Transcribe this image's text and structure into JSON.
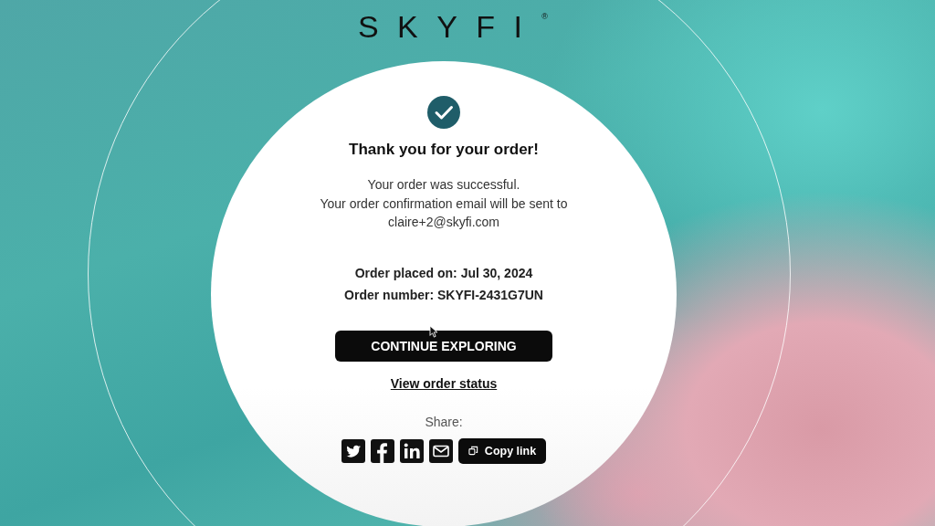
{
  "logo": {
    "text": "SKYFI",
    "mark": "®"
  },
  "confirmation": {
    "title": "Thank you for your order!",
    "message_lines": [
      "Your order was successful.",
      "Your order confirmation email will be sent to"
    ],
    "email": "claire+2@skyfi.com",
    "order_placed": "Order placed on: Jul 30, 2024",
    "order_number": "Order number: SKYFI-2431G7UN"
  },
  "primary_button": "CONTINUE EXPLORING",
  "status_link": "View order status",
  "share": {
    "label": "Share:",
    "buttons": [
      {
        "kind": "twitter"
      },
      {
        "kind": "facebook"
      },
      {
        "kind": "linkedin"
      },
      {
        "kind": "email"
      },
      {
        "kind": "copy",
        "label": "Copy link"
      }
    ]
  }
}
